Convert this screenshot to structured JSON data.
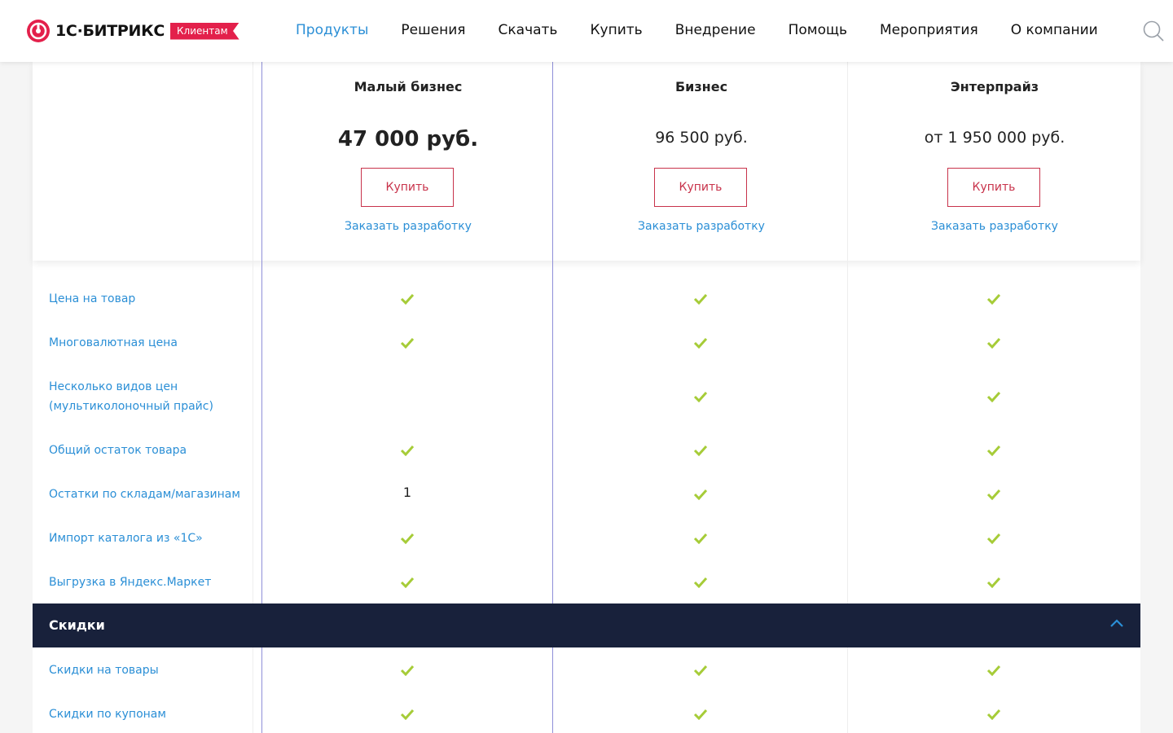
{
  "header": {
    "logo_text": "1С·БИТРИКС",
    "logo_badge": "Клиентам",
    "nav": [
      "Продукты",
      "Решения",
      "Скачать",
      "Купить",
      "Внедрение",
      "Помощь",
      "Мероприятия",
      "О компании"
    ],
    "active_nav": "Продукты"
  },
  "plans": [
    {
      "name": "Малый бизнес",
      "price": "47 000 руб.",
      "highlighted": true,
      "buy_label": "Купить",
      "order_label": "Заказать разработку"
    },
    {
      "name": "Бизнес",
      "price": "96 500 руб.",
      "highlighted": false,
      "buy_label": "Купить",
      "order_label": "Заказать разработку"
    },
    {
      "name": "Энтерпрайз",
      "price": "от 1 950 000 руб.",
      "highlighted": false,
      "buy_label": "Купить",
      "order_label": "Заказать разработку"
    }
  ],
  "rows": [
    {
      "label": "Цена на товар",
      "values": [
        "check",
        "check",
        "check"
      ]
    },
    {
      "label": "Многовалютная цена",
      "values": [
        "check",
        "check",
        "check"
      ]
    },
    {
      "label": "Несколько видов цен (мультиколоночный прайс)",
      "values": [
        "",
        "check",
        "check"
      ]
    },
    {
      "label": "Общий остаток товара",
      "values": [
        "check",
        "check",
        "check"
      ]
    },
    {
      "label": "Остатки по складам/магазинам",
      "values": [
        "1",
        "check",
        "check"
      ]
    },
    {
      "label": "Импорт каталога из «1С»",
      "values": [
        "check",
        "check",
        "check"
      ]
    },
    {
      "label": "Выгрузка в Яндекс.Маркет",
      "values": [
        "check",
        "check",
        "check"
      ]
    }
  ],
  "section": {
    "title": "Скидки"
  },
  "section_rows": [
    {
      "label": "Скидки на товары",
      "values": [
        "check",
        "check",
        "check"
      ]
    },
    {
      "label": "Скидки по купонам",
      "values": [
        "check",
        "check",
        "check"
      ]
    }
  ],
  "colors": {
    "accent_blue": "#2b8fd6",
    "brand_red": "#e3204b",
    "check_green": "#a6cc38",
    "section_dark": "#18213b"
  }
}
